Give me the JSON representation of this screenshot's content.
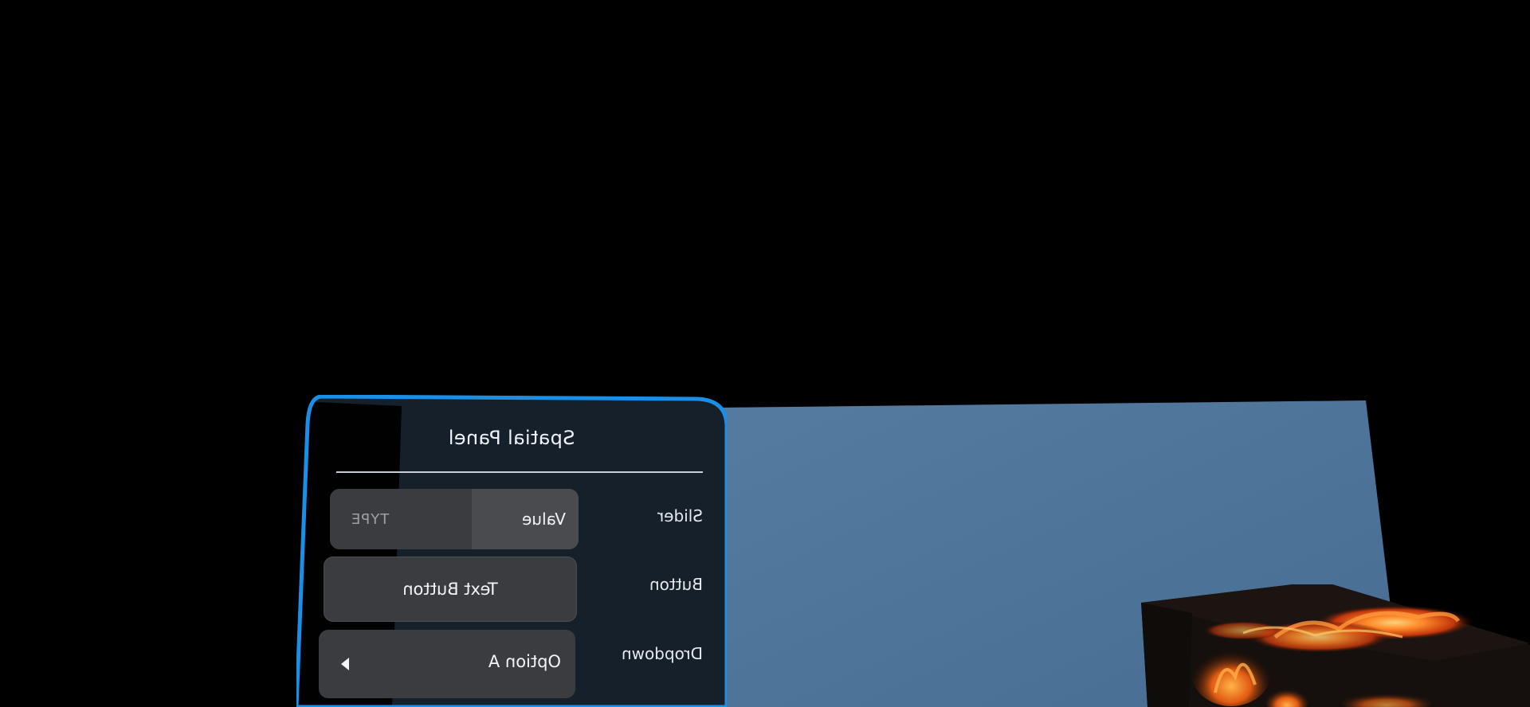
{
  "panel": {
    "title": "Spatial Panel",
    "accent_color": "#1a8fe8",
    "background_color": "#15202b",
    "mirrored": true,
    "rows": {
      "slider": {
        "label": "Slider",
        "value_text": "Value",
        "type_text": "TYPE",
        "fill_fraction": 0.43
      },
      "button": {
        "label": "Button",
        "button_text": "Text Button"
      },
      "dropdown": {
        "label": "Dropdown",
        "selected_option": "Option A",
        "arrow_icon": "dropdown-arrow-icon"
      }
    }
  },
  "scene": {
    "wall_color": "#4e7499",
    "background_color": "#000000",
    "cube_texture": "fire"
  }
}
